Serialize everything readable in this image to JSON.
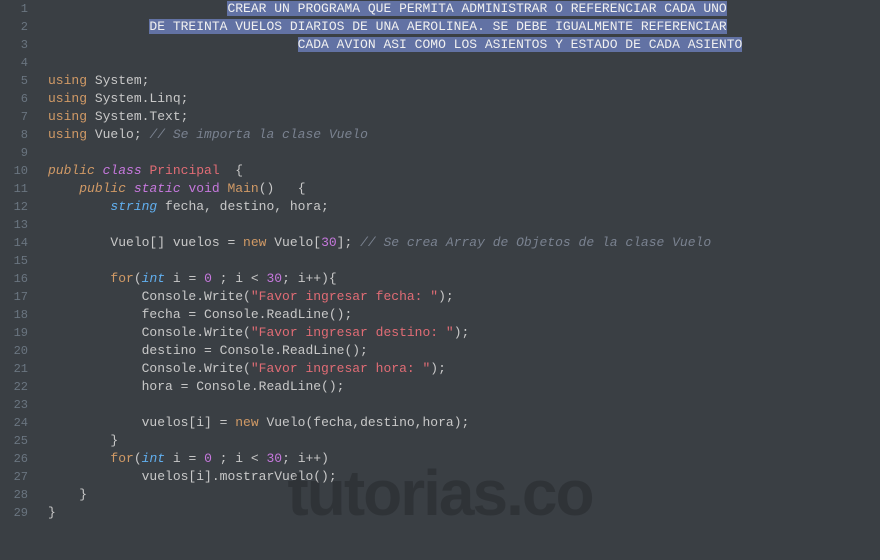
{
  "watermark": "tutorias.co",
  "lineNumbers": [
    "1",
    "2",
    "3",
    "4",
    "5",
    "6",
    "7",
    "8",
    "9",
    "10",
    "11",
    "12",
    "13",
    "14",
    "15",
    "16",
    "17",
    "18",
    "19",
    "20",
    "21",
    "22",
    "23",
    "24",
    "25",
    "26",
    "27",
    "28",
    "29"
  ],
  "code": {
    "comment1": "CREAR UN PROGRAMA QUE PERMITA ADMINISTRAR O REFERENCIAR CADA UNO",
    "comment2": "DE TREINTA VUELOS DIARIOS DE UNA AEROLINEA. SE DEBE IGUALMENTE REFERENCIAR",
    "comment3": "CADA AVION ASI COMO LOS ASIENTOS Y ESTADO DE CADA ASIENTO",
    "using1_kw": "using",
    "using1_ns": " System;",
    "using2_kw": "using",
    "using2_ns": " System.Linq;",
    "using3_kw": "using",
    "using3_ns": " System.Text;",
    "using4_kw": "using",
    "using4_ns": " Vuelo; ",
    "using4_cmt": "// Se importa la clase Vuelo",
    "pub": "public",
    "cls": "class",
    "clsName": "Principal",
    "brace_o": "  {",
    "pub2": "public",
    "static": "static",
    "void": "void",
    "main": "Main",
    "main_suffix": "()   {",
    "string": "string",
    "vars": " fecha, destino, hora;",
    "arr_pre": "Vuelo[] vuelos = ",
    "new": "new",
    "arr_mid": " Vuelo[",
    "thirty": "30",
    "arr_post": "]; ",
    "arr_cmt": "// Se crea Array de Objetos de la clase Vuelo",
    "for": "for",
    "int": "int",
    "for_i": " i = ",
    "zero": "0",
    "for_mid": " ; i < ",
    "for_end1": "; i++){",
    "for_end2": "; i++)",
    "cw": "Console.Write(",
    "str1": "\"Favor ingresar fecha: \"",
    "str2": "\"Favor ingresar destino: \"",
    "str3": "\"Favor ingresar hora: \"",
    "close": ");",
    "rl1": "fecha = Console.ReadLine();",
    "rl2": "destino = Console.ReadLine();",
    "rl3": "hora = Console.ReadLine();",
    "assign": "vuelos[i] = ",
    "assign_post": " Vuelo(fecha,destino,hora);",
    "brace_c": "}",
    "mostrar": "vuelos[i].mostrarVuelo();",
    "indent0": "",
    "indent1": "    ",
    "indent2": "        ",
    "indent3": "            ",
    "sp": " "
  }
}
